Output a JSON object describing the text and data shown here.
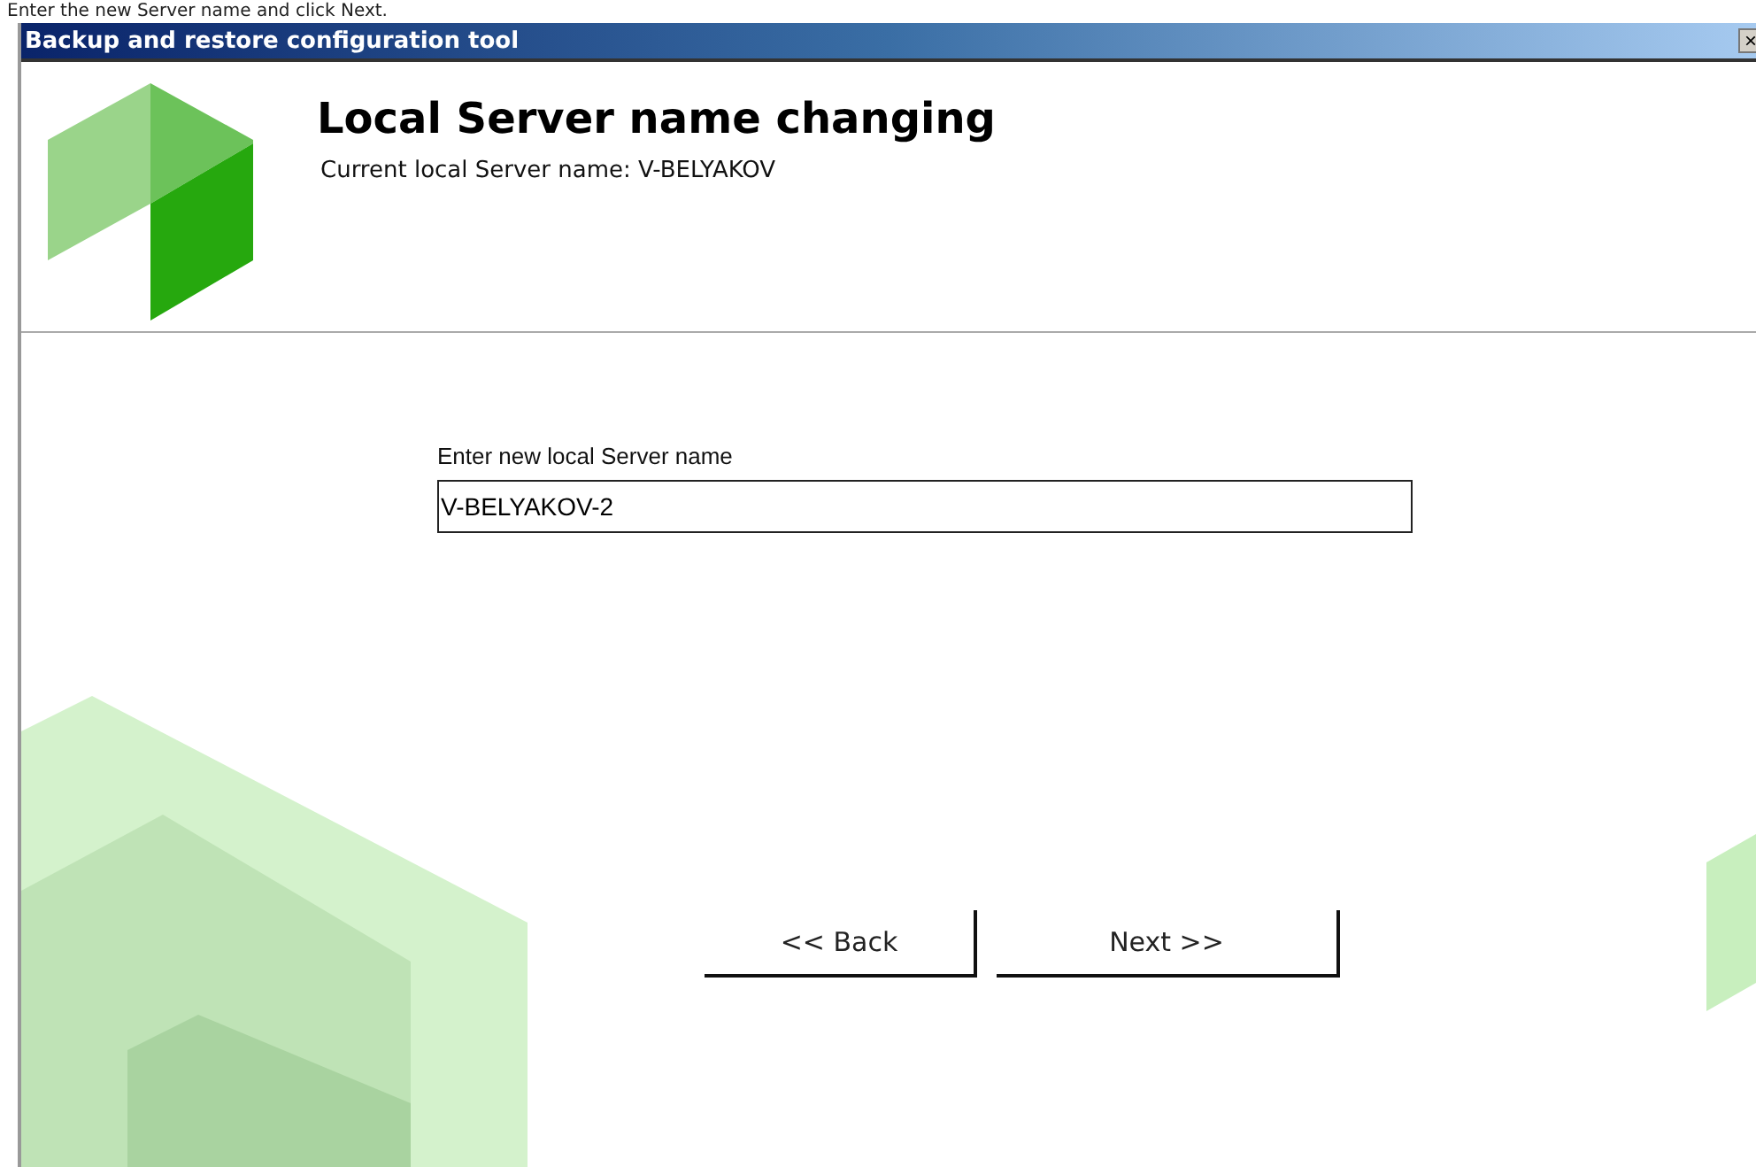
{
  "caption": "Enter the new Server name and click Next.",
  "window": {
    "title": "Backup and restore configuration tool",
    "close": "×"
  },
  "header": {
    "title": "Local Server name changing",
    "subtitle": "Current local Server name: V-BELYAKOV"
  },
  "form": {
    "label": "Enter new local Server name",
    "value": "V-BELYAKOV-2"
  },
  "buttons": [
    {
      "label": "<< Back",
      "kind": "back"
    },
    {
      "label": "Next >>",
      "kind": "next"
    }
  ]
}
